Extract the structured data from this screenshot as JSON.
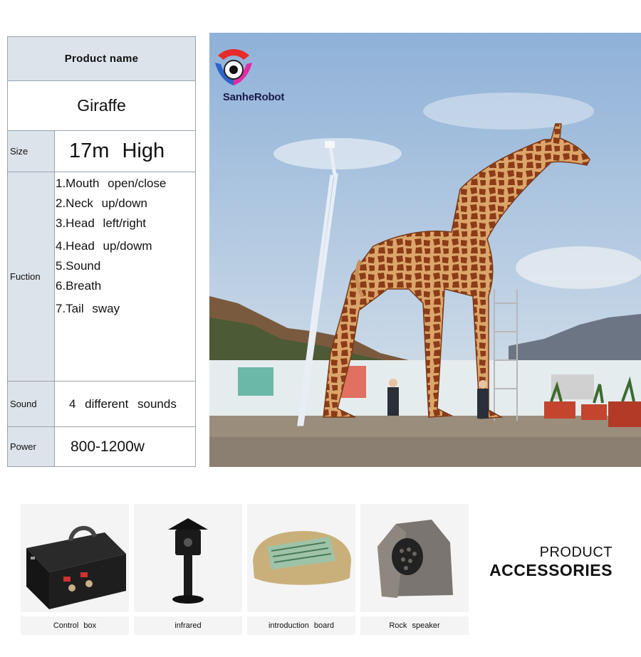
{
  "spec_table": {
    "header": "Product  name",
    "product_name": "Giraffe",
    "size_label": "Size",
    "size_value": "17m   High",
    "function_label": "Fuction",
    "functions": [
      "1.Mouth   open/close",
      "2.Neck   up/down",
      "3.Head   left/right",
      "4.Head   up/dowm",
      "5.Sound",
      "6.Breath",
      "7.Tail   sway"
    ],
    "sound_label": "Sound",
    "sound_value": "4  different  sounds",
    "power_label": "Power",
    "power_value": "800-1200w"
  },
  "brand": {
    "name": "SanheRobot"
  },
  "accessories": {
    "title_line1": "PRODUCT",
    "title_line2": "ACCESSORIES",
    "items": [
      {
        "label": "Control  box",
        "icon": "control-box"
      },
      {
        "label": "infrared",
        "icon": "infrared-sensor"
      },
      {
        "label": "introduction  board",
        "icon": "rock-sign-board"
      },
      {
        "label": "Rock  speaker",
        "icon": "rock-speaker"
      }
    ]
  },
  "colors": {
    "table_header_bg": "#dde3ea",
    "table_border": "#9aa3ad",
    "sky": "#a9c4e0",
    "giraffe_body": "#d9a36a",
    "giraffe_spots": "#8c3b17"
  }
}
